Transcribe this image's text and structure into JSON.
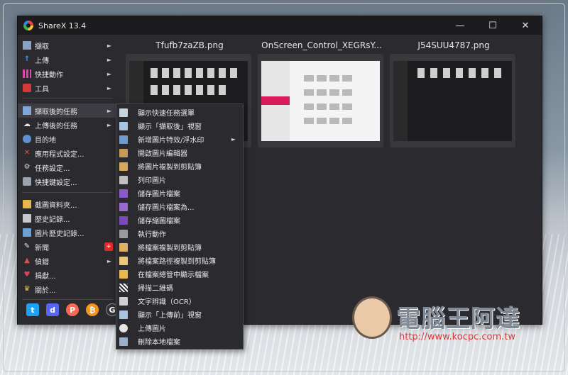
{
  "window": {
    "title": "ShareX 13.4",
    "minimize": "—",
    "maximize": "☐",
    "close": "✕"
  },
  "left_menu": [
    {
      "label": "擷取",
      "icon": "capture-icon",
      "arrow": "►"
    },
    {
      "label": "上傳",
      "icon": "upload-icon",
      "arrow": "►"
    },
    {
      "label": "快捷動作",
      "icon": "workflows-icon",
      "arrow": "►"
    },
    {
      "label": "工具",
      "icon": "tools-icon",
      "arrow": "►"
    },
    {
      "label": "擷取後的任務",
      "icon": "after-capture-icon",
      "arrow": "►"
    },
    {
      "label": "上傳後的任務",
      "icon": "after-upload-icon",
      "arrow": "►"
    },
    {
      "label": "目的地",
      "icon": "destinations-icon",
      "arrow": "►"
    },
    {
      "label": "應用程式設定...",
      "icon": "app-settings-icon"
    },
    {
      "label": "任務設定...",
      "icon": "task-settings-icon"
    },
    {
      "label": "快捷鍵設定...",
      "icon": "hotkey-settings-icon"
    },
    {
      "label": "截圖資料夾...",
      "icon": "screenshots-folder-icon"
    },
    {
      "label": "歷史記錄...",
      "icon": "history-icon"
    },
    {
      "label": "圖片歷史記錄...",
      "icon": "image-history-icon"
    },
    {
      "label": "新聞",
      "icon": "news-icon",
      "badge": "+"
    },
    {
      "label": "偵錯",
      "icon": "debug-icon",
      "arrow": "►"
    },
    {
      "label": "捐獻...",
      "icon": "donate-icon"
    },
    {
      "label": "關於...",
      "icon": "about-icon"
    }
  ],
  "thumbnails": [
    {
      "title": "Tfufb7zaZB.png"
    },
    {
      "title": "OnScreen_Control_XEGRsY..."
    },
    {
      "title": "J54SUU4787.png"
    }
  ],
  "submenu": [
    {
      "label": "顯示快速任務選單",
      "icon": "quick-task-menu-icon"
    },
    {
      "label": "顯示「擷取後」視窗",
      "icon": "after-capture-window-icon"
    },
    {
      "label": "新增圖片特效/浮水印",
      "icon": "image-effects-icon",
      "arrow": "►"
    },
    {
      "label": "開啟圖片編輯器",
      "icon": "image-editor-icon"
    },
    {
      "label": "將圖片複製到剪貼簿",
      "icon": "copy-image-icon"
    },
    {
      "label": "列印圖片",
      "icon": "print-icon"
    },
    {
      "label": "儲存圖片檔案",
      "icon": "save-image-icon"
    },
    {
      "label": "儲存圖片檔案為...",
      "icon": "save-image-as-icon"
    },
    {
      "label": "儲存縮圖檔案",
      "icon": "save-thumbnail-icon"
    },
    {
      "label": "執行動作",
      "icon": "perform-actions-icon"
    },
    {
      "label": "將檔案複製到剪貼簿",
      "icon": "copy-file-icon"
    },
    {
      "label": "將檔案路徑複製到剪貼簿",
      "icon": "copy-file-path-icon"
    },
    {
      "label": "在檔案總管中顯示檔案",
      "icon": "show-in-explorer-icon"
    },
    {
      "label": "掃描二維碼",
      "icon": "qr-code-icon"
    },
    {
      "label": "文字辨識（OCR）",
      "icon": "ocr-icon"
    },
    {
      "label": "顯示「上傳前」視窗",
      "icon": "before-upload-window-icon"
    },
    {
      "label": "上傳圖片",
      "icon": "upload-image-icon"
    },
    {
      "label": "刪除本地檔案",
      "icon": "delete-local-file-icon"
    }
  ],
  "social": [
    {
      "name": "twitter-icon",
      "glyph": "t",
      "color": "#1da1f2"
    },
    {
      "name": "discord-icon",
      "glyph": "d",
      "color": "#5865f2"
    },
    {
      "name": "patreon-icon",
      "glyph": "P",
      "color": "#f96854"
    },
    {
      "name": "bitcoin-icon",
      "glyph": "₿",
      "color": "#f7931a"
    },
    {
      "name": "github-icon",
      "glyph": "G",
      "color": "#333333"
    }
  ],
  "watermark": {
    "text": "電腦王阿達",
    "url": "http://www.kocpc.com.tw"
  }
}
